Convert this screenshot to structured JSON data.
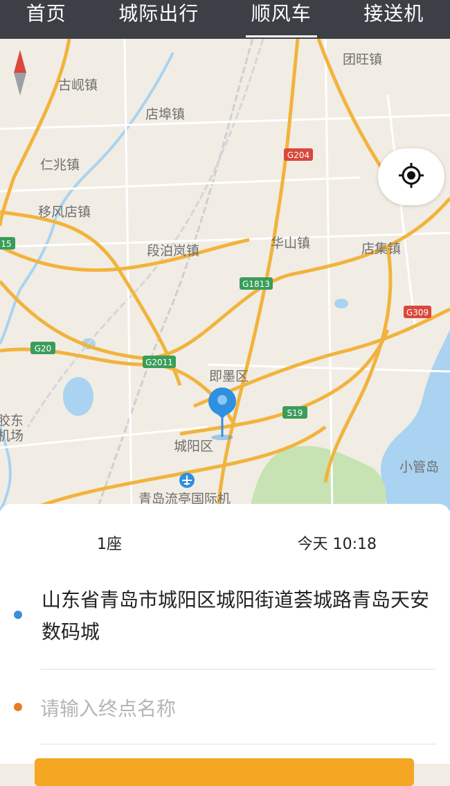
{
  "tabs": [
    {
      "label": "首页",
      "active": false
    },
    {
      "label": "城际出行",
      "active": false
    },
    {
      "label": "顺风车",
      "active": true
    },
    {
      "label": "接送机",
      "active": false
    }
  ],
  "map": {
    "places": {
      "gujian": "古岘镇",
      "tuanwang": "团旺镇",
      "dianbu": "店埠镇",
      "renzhao": "仁兆镇",
      "yifengdian": "移风店镇",
      "duanbolan": "段泊岚镇",
      "huashan": "华山镇",
      "dianji": "店集镇",
      "jimo": "即墨区",
      "chengyang": "城阳区",
      "airport": "青岛流亭国际机",
      "xiaoguan": "小管岛",
      "jiaodong_a": "胶东",
      "jiaodong_b": "机场"
    },
    "highways": {
      "g204": "G204",
      "g1813": "G1813",
      "g309": "G309",
      "g20": "G20",
      "g2011": "G2011",
      "s19": "S19",
      "g15": "15"
    },
    "colors": {
      "road": "#f2b33d",
      "water": "#a9d3f0",
      "green": "#c7e3b4",
      "pin": "#2f8fe0"
    }
  },
  "trip": {
    "seats": "1座",
    "time": "今天 10:18",
    "start_address": "山东省青岛市城阳区城阳街道荟城路青岛天安数码城",
    "end_placeholder": "请输入终点名称",
    "end_value": ""
  },
  "theme": {
    "topbar": "#3d3f46",
    "accent": "#f5a623",
    "start_dot": "#3b8fd9",
    "end_dot": "#e57c27"
  }
}
